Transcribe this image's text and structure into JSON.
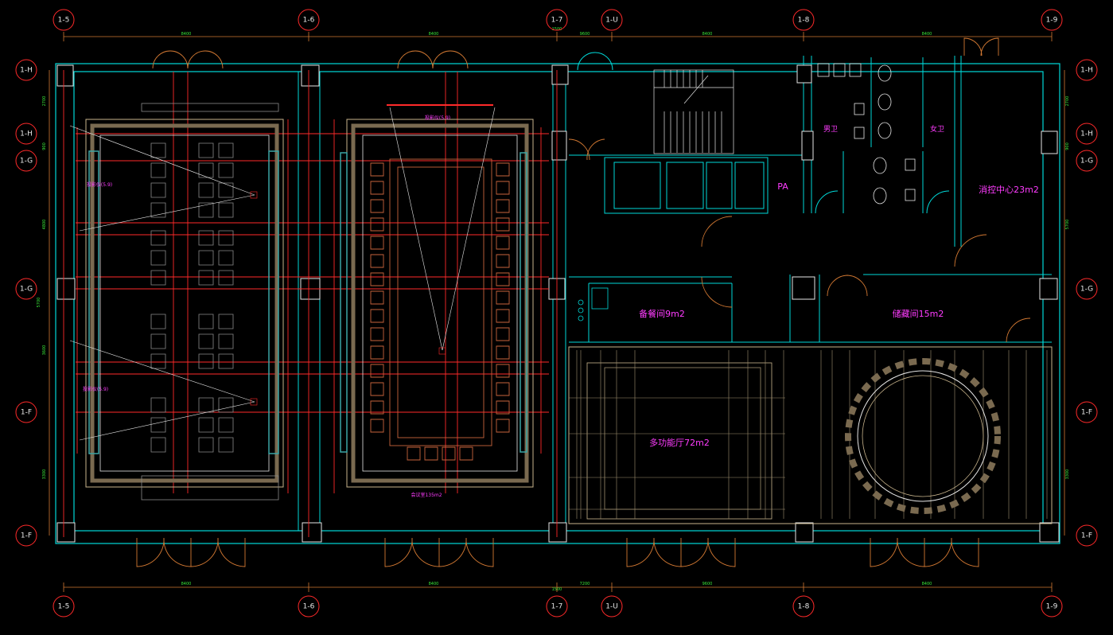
{
  "drawing": {
    "background": "#000000",
    "colors": {
      "wall": "#00d9d9",
      "axis": "#ff2a2a",
      "room_text": "#ff3cff",
      "furniture": "#c8643c",
      "furniture_alt": "#c8b48c",
      "dimension": "#39e639",
      "structure": "#e6e6e6",
      "door": "#d27832"
    },
    "grid_top": [
      "1-5",
      "1-6",
      "1-7",
      "1-U",
      "1-8",
      "1-9"
    ],
    "grid_bottom": [
      "1-5",
      "1-6",
      "1-7",
      "1-U",
      "1-8",
      "1-9"
    ],
    "grid_left": [
      "1-H",
      "1-H",
      "1-G",
      "1-G",
      "1-F",
      "1-F"
    ],
    "grid_right": [
      "1-H",
      "1-H",
      "1-G",
      "1-G",
      "1-F",
      "1-F"
    ],
    "dims_top": [
      "8400",
      "8400",
      "1500",
      "9600",
      "8400",
      "8400"
    ],
    "dims_bottom": [
      "8400",
      "8400",
      "1500",
      "7200",
      "9600",
      "8400"
    ],
    "dims_left": [
      "2700",
      "900",
      "4800",
      "5700",
      "3600",
      "3300"
    ],
    "dims_right": [
      "2700",
      "900",
      "5700",
      "3300"
    ],
    "rooms": {
      "restroom_male": "男卫",
      "restroom_female": "女卫",
      "fire_control": "消控中心23m2",
      "pa": "PA",
      "spare_room": "备餐间9m2",
      "storage": "储藏间15m2",
      "meeting_room": "会议室135m2",
      "multi_function": "多功能厅72m2",
      "projector_1": "投影仪(5.9)",
      "projector_2": "投影仪(5.9)",
      "projector_3": "投影仪(5.9)"
    }
  }
}
